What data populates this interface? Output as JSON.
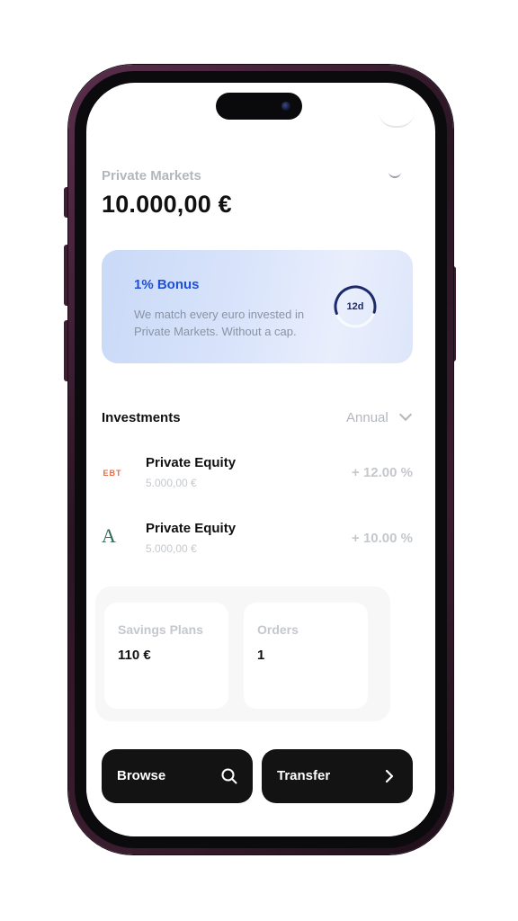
{
  "private_markets": {
    "label": "Private Markets",
    "balance": "10.000,00 €"
  },
  "bonus": {
    "title": "1% Bonus",
    "description": "We match every euro invested in Private Markets. Without a cap.",
    "days_left": "12d",
    "progress_fraction": 0.6,
    "accent_color": "#1e4fd8"
  },
  "investments": {
    "title": "Investments",
    "period": "Annual",
    "items": [
      {
        "logo_text": "EBT",
        "name": "Private Equity",
        "amount": "5.000,00 €",
        "return": "+ 12.00 %"
      },
      {
        "logo_text": "A",
        "name": "Private Equity",
        "amount": "5.000,00 €",
        "return": "+ 10.00 %"
      }
    ]
  },
  "tiles": [
    {
      "label": "Savings Plans",
      "value": "110 €"
    },
    {
      "label": "Orders",
      "value": "1"
    }
  ],
  "actions": {
    "browse_label": "Browse",
    "browse_icon": "search-icon",
    "transfer_label": "Transfer",
    "transfer_icon": "chevron-right-icon"
  }
}
